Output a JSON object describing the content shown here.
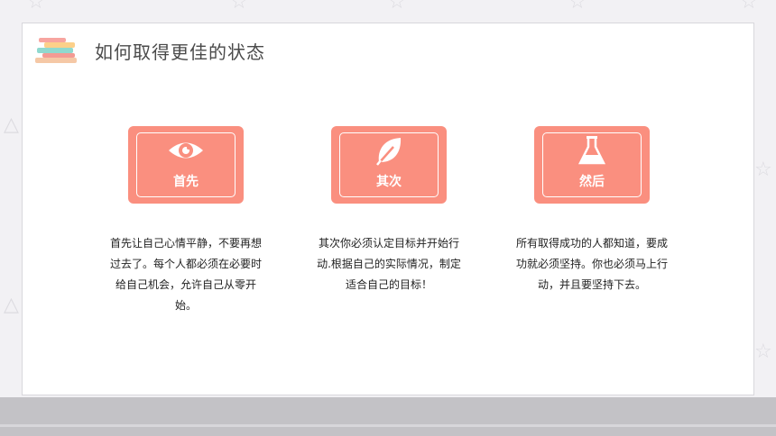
{
  "slide": {
    "title": "如何取得更佳的状态"
  },
  "cards": [
    {
      "label": "首先",
      "icon": "eye-icon",
      "description": "首先让自己心情平静，不要再想过去了。每个人都必须在必要时给自己机会，允许自己从零开始。"
    },
    {
      "label": "其次",
      "icon": "leaf-icon",
      "description": "其次你必须认定目标并开始行动.根据自己的实际情况，制定适合自己的目标！"
    },
    {
      "label": "然后",
      "icon": "flask-icon",
      "description": "所有取得成功的人都知道，要成功就必须坚持。你也必须马上行动，并且要坚持下去。"
    }
  ],
  "colors": {
    "accent": "#fa8f7f",
    "background": "#f2f1f4",
    "footer": "#c3c2c6"
  }
}
